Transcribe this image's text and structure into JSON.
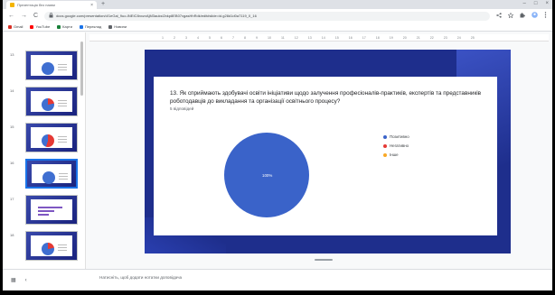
{
  "browser": {
    "tab_title": "Презентація без назви",
    "tab_close": "×",
    "new_tab": "+",
    "window_controls": [
      "–",
      "□",
      "×"
    ],
    "nav": {
      "back": "←",
      "forward": "→",
      "reload": "C"
    },
    "url": "docs.google.com/presentation/d/1eGal_9uo-INEIC8nxzvAjM3auksI2xkp8EB07xgasHhRdk/edit#slide=id.g28d1d0a7119_0_16",
    "toolbar_icons": [
      "share-icon",
      "star-icon",
      "extensions-icon",
      "profile-icon",
      "menu-icon"
    ]
  },
  "bookmarks": [
    {
      "label": "Gmail",
      "color": "#d93025"
    },
    {
      "label": "YouTube",
      "color": "#ff0000"
    },
    {
      "label": "Карти",
      "color": "#188038"
    },
    {
      "label": "Переклад",
      "color": "#1a73e8"
    },
    {
      "label": "Новини",
      "color": "#5f6368"
    }
  ],
  "ruler": {
    "ticks": [
      "1",
      "2",
      "3",
      "4",
      "5",
      "6",
      "7",
      "8",
      "9",
      "10",
      "11",
      "12",
      "13",
      "14",
      "15",
      "16",
      "17",
      "18",
      "19",
      "20",
      "21",
      "22",
      "23",
      "24",
      "25"
    ]
  },
  "filmstrip": {
    "slides": [
      {
        "number": "13",
        "kind": "pie-full"
      },
      {
        "number": "14",
        "kind": "pie-small"
      },
      {
        "number": "15",
        "kind": "pie-split"
      },
      {
        "number": "16",
        "kind": "pie-full",
        "active": true
      },
      {
        "number": "17",
        "kind": "bars"
      },
      {
        "number": "18",
        "kind": "pie-small"
      }
    ]
  },
  "slide": {
    "question": "13. Як сприймають здобувачі освіти ініціативи щодо залучення професіоналів-практиків, експертів та представників роботодавців до викладання та організації освітнього процесу?",
    "responses": "5 відповідей",
    "pie_label": "100%",
    "chart_data": {
      "type": "pie",
      "categories": [
        "Позитивно",
        "Негативно",
        "Інше"
      ],
      "values": [
        100,
        0,
        0
      ],
      "colors": [
        "#3a63c9",
        "#e53935",
        "#f9a825"
      ]
    }
  },
  "notes": {
    "placeholder": "Натисніть, щоб додати нотатки доповідача"
  },
  "bottom_controls": [
    "grid-view-icon",
    "collapse-icon"
  ],
  "bottom_glyphs": [
    "▦",
    "‹"
  ]
}
